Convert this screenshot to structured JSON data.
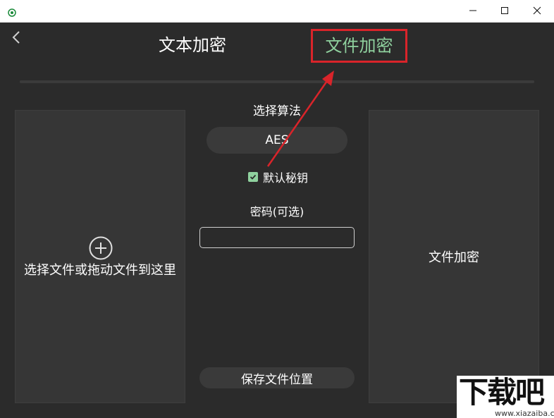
{
  "titlebar": {
    "icons": {
      "app": "app-logo-icon",
      "minimize": "minimize-icon",
      "maximize": "maximize-icon",
      "close": "close-icon"
    }
  },
  "header": {
    "back_icon": "chevron-left-icon",
    "tabs": [
      {
        "label": "文本加密",
        "active": false
      },
      {
        "label": "文件加密",
        "active": true
      }
    ]
  },
  "dropzone": {
    "icon": "plus-circle-icon",
    "label": "选择文件或拖动文件到这里"
  },
  "algorithm": {
    "label": "选择算法",
    "selected": "AES"
  },
  "default_key": {
    "label": "默认秘钥",
    "checked": true
  },
  "password": {
    "label": "密码(可选)",
    "value": ""
  },
  "save_location_button": "保存文件位置",
  "encrypt_button": "文件加密",
  "watermark": {
    "main": "下载吧",
    "sub": "www.xiazaiba.com"
  },
  "colors": {
    "background": "#2b2b2b",
    "panel": "#363636",
    "accent": "#8fd19e",
    "annotation": "#d9242a"
  }
}
